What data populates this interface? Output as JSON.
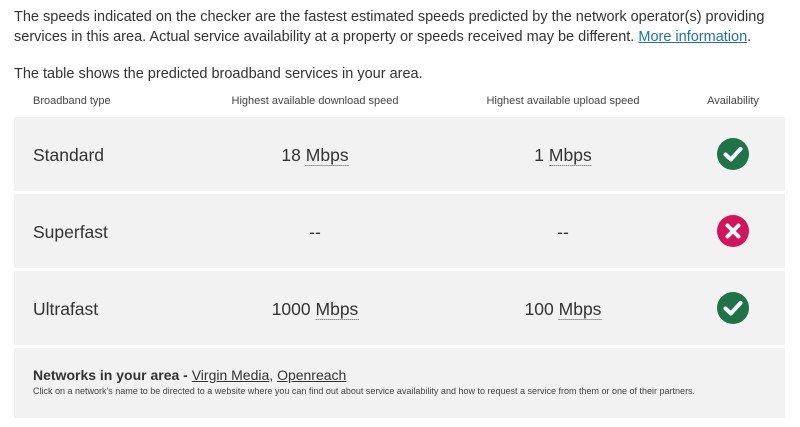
{
  "intro": {
    "text": "The speeds indicated on the checker are the fastest estimated speeds predicted by the network operator(s) providing services in this area. Actual service availability at a property or speeds received may be different.",
    "link": "More information",
    "after_link": "."
  },
  "lead": "The table shows the predicted broadband services in your area.",
  "table": {
    "headers": {
      "type": "Broadband type",
      "download": "Highest available download speed",
      "upload": "Highest available upload speed",
      "availability": "Availability"
    },
    "rows": [
      {
        "type": "Standard",
        "download": "18",
        "download_unit": "Mbps",
        "upload": "1",
        "upload_unit": "Mbps",
        "available": true
      },
      {
        "type": "Superfast",
        "download": "--",
        "download_unit": "",
        "upload": "--",
        "upload_unit": "",
        "available": false
      },
      {
        "type": "Ultrafast",
        "download": "1000",
        "download_unit": "Mbps",
        "upload": "100",
        "upload_unit": "Mbps",
        "available": true
      }
    ]
  },
  "networks": {
    "title": "Networks in your area - ",
    "links": [
      "Virgin Media",
      "Openreach"
    ],
    "separator": ", ",
    "help": "Click on a network's name to be directed to a website where you can find out about service availability and how to request a service from them or one of their partners."
  },
  "colors": {
    "link": "#1d70b8",
    "available": "#1e7348",
    "unavailable": "#d4145a",
    "row_bg": "#f2f2f2"
  },
  "icons": {
    "available": "check-circle-icon",
    "unavailable": "cross-circle-icon"
  }
}
